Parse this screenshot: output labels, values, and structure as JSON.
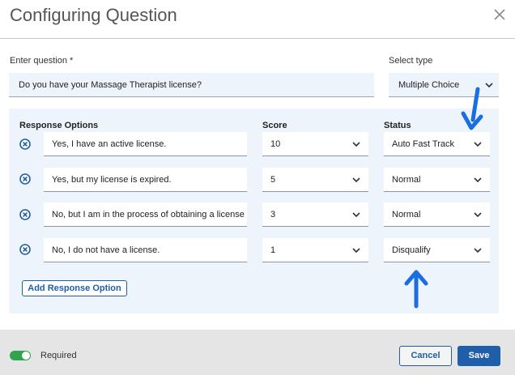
{
  "dialog": {
    "title": "Configuring Question",
    "close_icon": "close-icon"
  },
  "question": {
    "label": "Enter question *",
    "value": "Do you have your Massage Therapist license?"
  },
  "type": {
    "label": "Select type",
    "value": "Multiple Choice"
  },
  "responses": {
    "headers": {
      "options": "Response Options",
      "score": "Score",
      "status": "Status"
    },
    "rows": [
      {
        "text": "Yes, I have an active license.",
        "score": "10",
        "status": "Auto Fast Track"
      },
      {
        "text": "Yes, but my license is expired.",
        "score": "5",
        "status": "Normal"
      },
      {
        "text": "No, but I am in the process of obtaining a license",
        "score": "3",
        "status": "Normal"
      },
      {
        "text": "No, I do not have a license.",
        "score": "1",
        "status": "Disqualify"
      }
    ],
    "add_label": "Add Response Option"
  },
  "footer": {
    "required_label": "Required",
    "required_on": true,
    "cancel_label": "Cancel",
    "save_label": "Save"
  },
  "colors": {
    "accent": "#1f5ea8",
    "panel": "#eef4fc",
    "annotation_arrow": "#1a6fe0",
    "toggle_on": "#2ea44f"
  }
}
